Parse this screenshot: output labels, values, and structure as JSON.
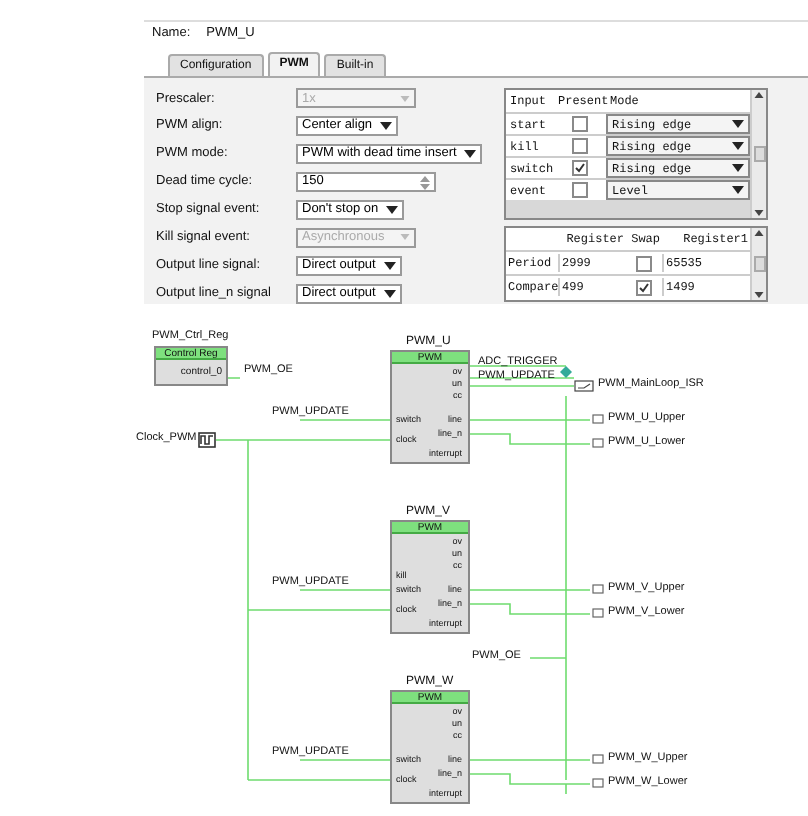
{
  "dialog": {
    "name_label": "Name:",
    "name_value": "PWM_U",
    "tabs": [
      {
        "label": "Configuration",
        "selected": false
      },
      {
        "label": "PWM",
        "selected": true
      },
      {
        "label": "Built-in",
        "selected": false
      }
    ],
    "form": [
      {
        "label": "Prescaler:",
        "kind": "select",
        "value": "1x",
        "disabled": true
      },
      {
        "label": "PWM align:",
        "kind": "select",
        "value": "Center align",
        "disabled": false
      },
      {
        "label": "PWM mode:",
        "kind": "select",
        "value": "PWM with dead time insert",
        "disabled": false
      },
      {
        "label": "Dead time cycle:",
        "kind": "spin",
        "value": "150",
        "disabled": false
      },
      {
        "label": "Stop signal event:",
        "kind": "select",
        "value": "Don't stop on",
        "disabled": false
      },
      {
        "label": "Kill signal event:",
        "kind": "select",
        "value": "Asynchronous",
        "disabled": true
      },
      {
        "label": "Output line signal:",
        "kind": "select",
        "value": "Direct output",
        "disabled": false
      },
      {
        "label": "Output line_n signal",
        "kind": "select",
        "value": "Direct output",
        "disabled": false
      }
    ],
    "input_table": {
      "columns": [
        "Input",
        "Present",
        "Mode"
      ],
      "rows": [
        {
          "input": "start",
          "present": false,
          "mode": "Rising edge"
        },
        {
          "input": "kill",
          "present": false,
          "mode": "Rising edge"
        },
        {
          "input": "switch",
          "present": true,
          "mode": "Rising edge"
        },
        {
          "input": "event",
          "present": false,
          "mode": "Level"
        }
      ]
    },
    "register_table": {
      "columns": [
        "Register",
        "Swap",
        "Register1"
      ],
      "rows": [
        {
          "name": "Period",
          "register": "2999",
          "swap": false,
          "register1": "65535"
        },
        {
          "name": "Compare",
          "register": "499",
          "swap": true,
          "register1": "1499"
        }
      ]
    }
  },
  "schematic": {
    "control_reg": {
      "title": "PWM_Ctrl_Reg",
      "header": "Control Reg",
      "pin": "control_0",
      "net": "PWM_OE"
    },
    "clock_label": "Clock_PWM",
    "trigger_labels": [
      "ADC_TRIGGER",
      "PWM_UPDATE"
    ],
    "isr_label": "PWM_MainLoop_ISR",
    "oe_label": "PWM_OE",
    "blocks": [
      {
        "title": "PWM_U",
        "header": "PWM",
        "right_pins": [
          "ov",
          "un",
          "cc",
          "line",
          "line_n",
          "interrupt"
        ],
        "left_pins": [
          "switch",
          "clock"
        ],
        "input_net": "PWM_UPDATE",
        "outputs": [
          "PWM_U_Upper",
          "PWM_U_Lower"
        ]
      },
      {
        "title": "PWM_V",
        "header": "PWM",
        "right_pins": [
          "ov",
          "un",
          "cc",
          "line",
          "line_n",
          "interrupt"
        ],
        "left_pins": [
          "kill",
          "switch",
          "clock"
        ],
        "input_net": "PWM_UPDATE",
        "outputs": [
          "PWM_V_Upper",
          "PWM_V_Lower"
        ]
      },
      {
        "title": "PWM_W",
        "header": "PWM",
        "right_pins": [
          "ov",
          "un",
          "cc",
          "line",
          "line_n",
          "interrupt"
        ],
        "left_pins": [
          "switch",
          "clock"
        ],
        "input_net": "PWM_UPDATE",
        "outputs": [
          "PWM_W_Upper",
          "PWM_W_Lower"
        ]
      }
    ]
  }
}
